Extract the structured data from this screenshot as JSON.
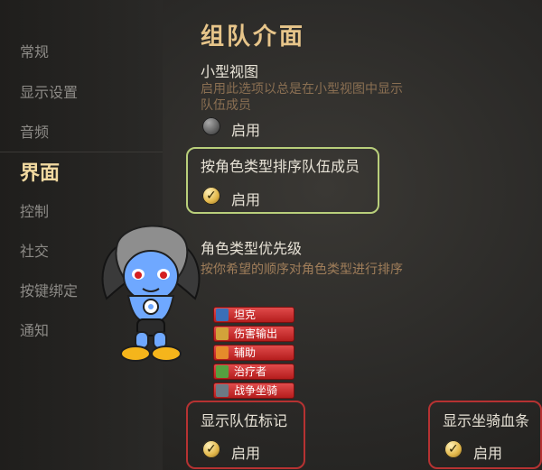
{
  "sidebar": {
    "items": [
      {
        "label": "常规"
      },
      {
        "label": "显示设置"
      },
      {
        "label": "音频"
      },
      {
        "label": "界面"
      },
      {
        "label": "控制"
      },
      {
        "label": "社交"
      },
      {
        "label": "按键绑定"
      },
      {
        "label": "通知"
      }
    ],
    "active_index": 3
  },
  "main": {
    "title": "组队介面",
    "mini_view": {
      "label": "小型视图",
      "description_line1": "启用此选项以总是在小型视图中显示",
      "description_line2": "队伍成员",
      "option": {
        "label": "启用",
        "enabled": false
      }
    },
    "sort_by_role": {
      "label": "按角色类型排序队伍成员",
      "option": {
        "label": "启用",
        "enabled": true
      }
    },
    "role_priority": {
      "label": "角色类型优先级",
      "description": "按你希望的顺序对角色类型进行排序",
      "roles": [
        {
          "label": "坦克",
          "icon": "shield-icon"
        },
        {
          "label": "伤害输出",
          "icon": "sword-icon"
        },
        {
          "label": "辅助",
          "icon": "support-icon"
        },
        {
          "label": "治疗者",
          "icon": "healer-icon"
        },
        {
          "label": "战争坐骑",
          "icon": "mount-icon"
        }
      ]
    },
    "show_team_markers": {
      "label": "显示队伍标记",
      "option": {
        "label": "启用",
        "enabled": true
      }
    },
    "show_mount_health": {
      "label": "显示坐骑血条",
      "option": {
        "label": "启用",
        "enabled": true
      }
    }
  },
  "colors": {
    "title": "#e7c58a",
    "active_nav": "#f1d9a0",
    "highlight_green": "#b9cf7b",
    "highlight_red": "#b63232",
    "role_bar": "#c92f2f"
  }
}
